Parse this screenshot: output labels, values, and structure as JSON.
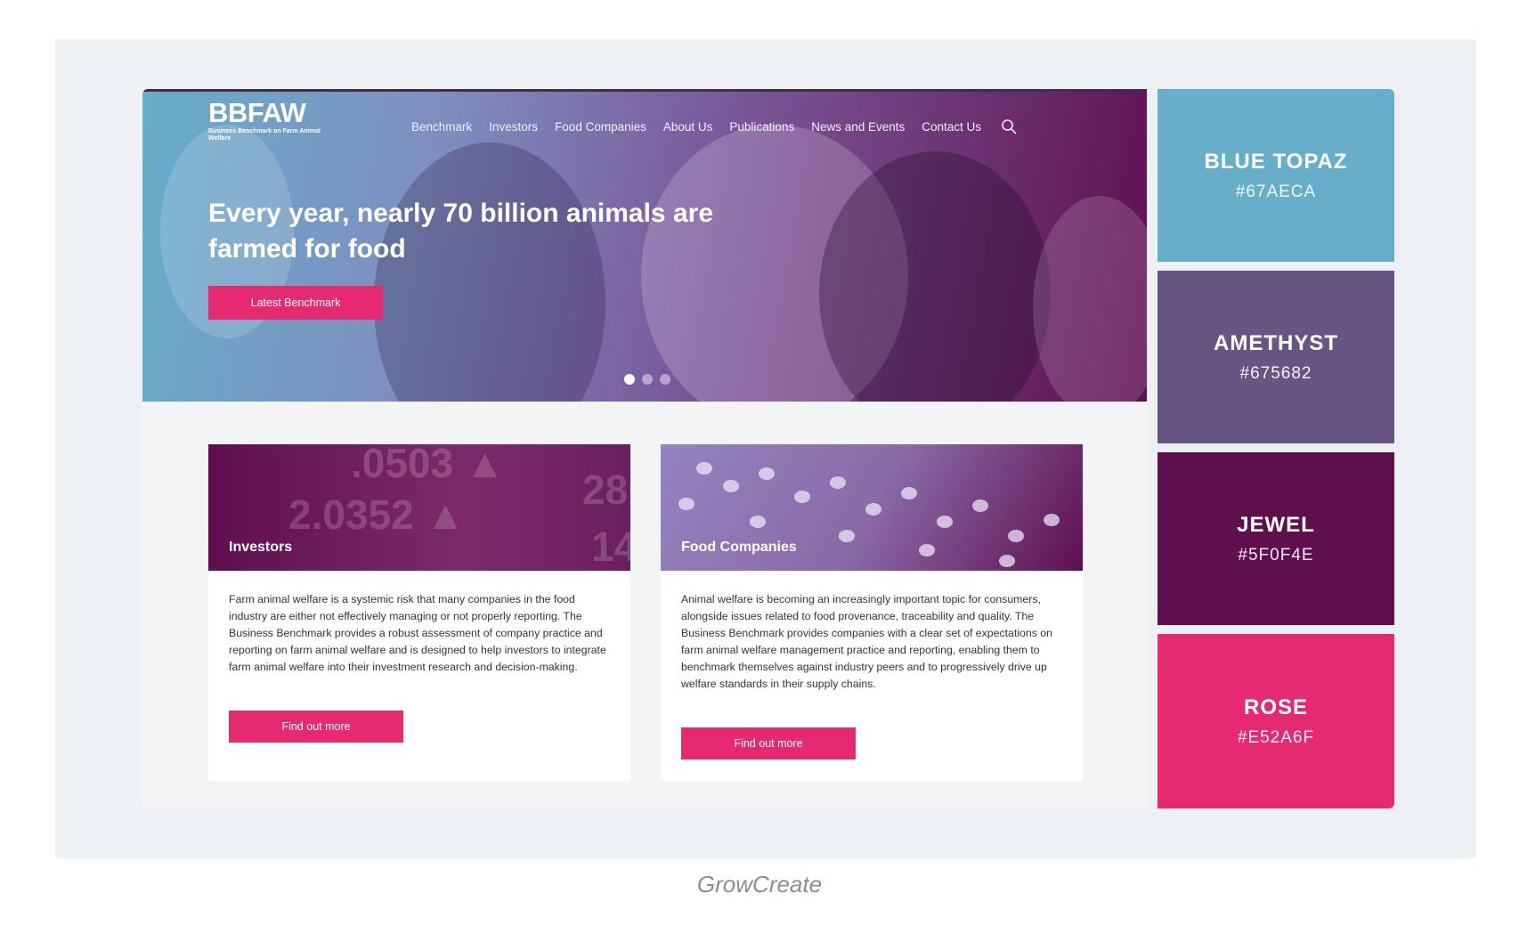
{
  "site": {
    "logo": {
      "mark": "BBFAW",
      "subtitle": "Business Benchmark on Farm Animal Welfare"
    },
    "nav": [
      "Benchmark",
      "Investors",
      "Food Companies",
      "About Us",
      "Publications",
      "News and Events",
      "Contact Us"
    ],
    "hero": {
      "title": "Every year, nearly 70 billion animals are farmed for food",
      "button": "Latest Benchmark",
      "slide_count": 3,
      "active_slide": 1
    },
    "cards": [
      {
        "title": "Investors",
        "body": "Farm animal welfare is a systemic risk that many companies in the food industry are either not effectively managing or not properly reporting. The Business Benchmark provides a robust assessment of company practice and reporting on farm animal welfare and is designed to help investors to integrate farm animal welfare into their investment research and decision-making.",
        "button": "Find out more"
      },
      {
        "title": "Food Companies",
        "body": "Animal welfare is becoming an increasingly important topic for consumers, alongside issues related to food provenance, traceability and quality. The Business Benchmark provides companies with a clear set of expectations on farm animal welfare management practice and reporting, enabling them to benchmark themselves against industry peers and to progressively drive up welfare standards in their supply chains.",
        "button": "Find out more"
      }
    ]
  },
  "palette": [
    {
      "name": "BLUE TOPAZ",
      "hex": "#67AECA",
      "color": "#67aeca"
    },
    {
      "name": "AMETHYST",
      "hex": "#675682",
      "color": "#675682"
    },
    {
      "name": "JEWEL",
      "hex": "#5F0F4E",
      "color": "#5f0f4e"
    },
    {
      "name": "ROSE",
      "hex": "#E52A6F",
      "color": "#e52a6f"
    }
  ],
  "caption": "GrowCreate"
}
